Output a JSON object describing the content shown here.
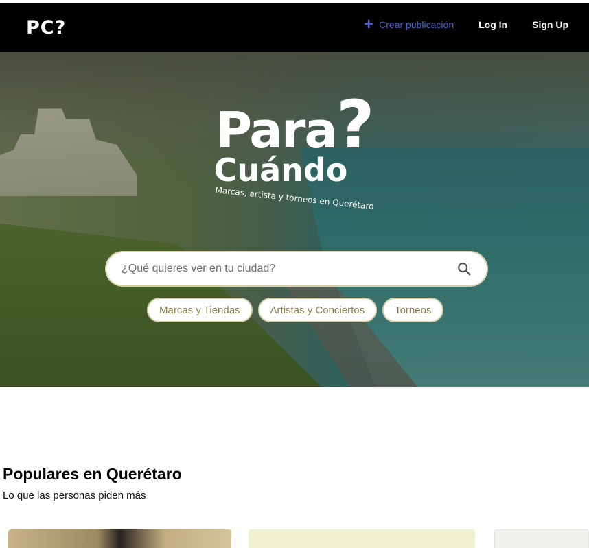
{
  "navbar": {
    "logo": "PC?",
    "create_label": "Crear publicación",
    "login_label": "Log In",
    "signup_label": "Sign Up"
  },
  "hero": {
    "brand_line1": "Para",
    "brand_q": "?",
    "brand_line2": "Cuándo",
    "tagline": "Marcas, artista y torneos en Querétaro",
    "search": {
      "placeholder": "¿Qué quieres ver en tu ciudad?"
    },
    "chips": [
      {
        "label": "Marcas y Tiendas"
      },
      {
        "label": "Artistas y Conciertos"
      },
      {
        "label": "Torneos"
      }
    ]
  },
  "popular": {
    "title": "Populares en Querétaro",
    "subtitle": "Lo que las personas piden más"
  },
  "colors": {
    "accent_blue": "#4a63c9",
    "chip_text": "#8a7d48",
    "chip_border": "#d6cfa6",
    "navbar_bg": "#000000"
  },
  "icons": {
    "create": "plus-icon",
    "search": "search-icon"
  }
}
